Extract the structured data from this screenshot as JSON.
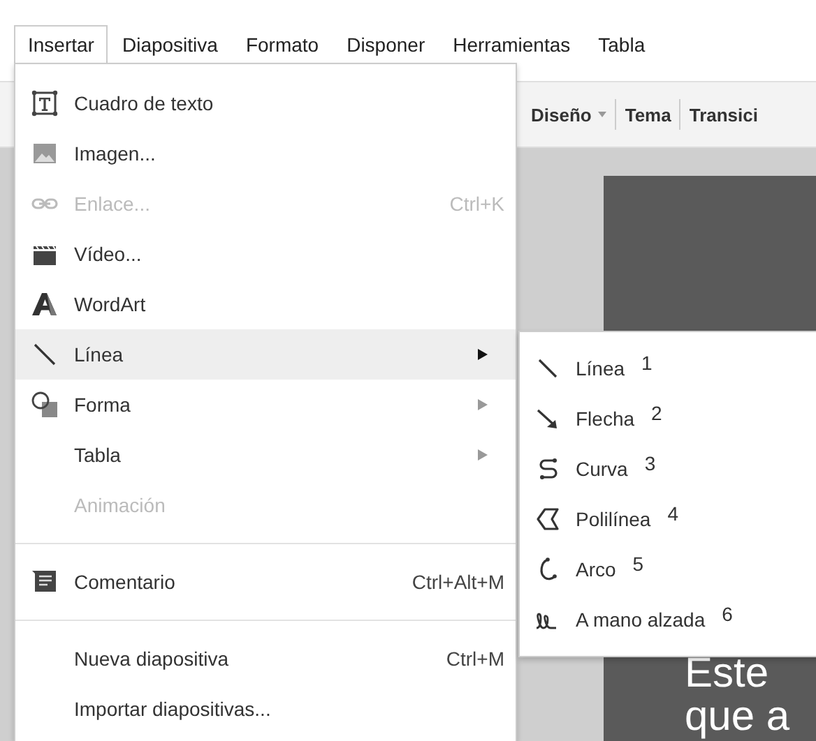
{
  "menu_bar": [
    {
      "label": "Insertar",
      "selected": true
    },
    {
      "label": "Diapositiva",
      "selected": false
    },
    {
      "label": "Formato",
      "selected": false
    },
    {
      "label": "Disponer",
      "selected": false
    },
    {
      "label": "Herramientas",
      "selected": false
    },
    {
      "label": "Tabla",
      "selected": false
    }
  ],
  "toolbar": [
    {
      "label": "Diseño",
      "kind": "dropdown"
    },
    {
      "label": "Tema",
      "kind": "button"
    },
    {
      "label": "Transici",
      "kind": "button"
    }
  ],
  "slide": {
    "body": [
      "Este",
      "que a"
    ]
  },
  "menu": {
    "sections": [
      [
        {
          "label": "Cuadro de texto",
          "disabled": false,
          "highlighted": false,
          "has_submenu": false
        },
        {
          "label": "Imagen...",
          "disabled": false,
          "highlighted": false,
          "has_submenu": false
        },
        {
          "label": "Enlace...",
          "shortcut": "Ctrl+K",
          "disabled": true,
          "highlighted": false,
          "has_submenu": false
        },
        {
          "label": "Vídeo...",
          "disabled": false,
          "highlighted": false,
          "has_submenu": false
        },
        {
          "label": "WordArt",
          "disabled": false,
          "highlighted": false,
          "has_submenu": false
        },
        {
          "label": "Línea",
          "disabled": false,
          "highlighted": true,
          "has_submenu": true
        },
        {
          "label": "Forma",
          "disabled": false,
          "highlighted": false,
          "has_submenu": true
        },
        {
          "label": "Tabla",
          "disabled": false,
          "highlighted": false,
          "has_submenu": true
        },
        {
          "label": "Animación",
          "disabled": true,
          "highlighted": false,
          "has_submenu": false
        }
      ],
      [
        {
          "label": "Comentario",
          "shortcut": "Ctrl+Alt+M",
          "disabled": false,
          "highlighted": false,
          "has_submenu": false
        }
      ],
      [
        {
          "label": "Nueva diapositiva",
          "shortcut": "Ctrl+M",
          "disabled": false,
          "highlighted": false,
          "has_submenu": false
        },
        {
          "label": "Importar diapositivas...",
          "disabled": false,
          "highlighted": false,
          "has_submenu": false
        }
      ]
    ]
  },
  "submenu": [
    {
      "label": "Línea",
      "number": "1"
    },
    {
      "label": "Flecha",
      "number": "2"
    },
    {
      "label": "Curva",
      "number": "3"
    },
    {
      "label": "Polilínea",
      "number": "4"
    },
    {
      "label": "Arco",
      "number": "5"
    },
    {
      "label": "A mano alzada",
      "number": "6"
    }
  ]
}
